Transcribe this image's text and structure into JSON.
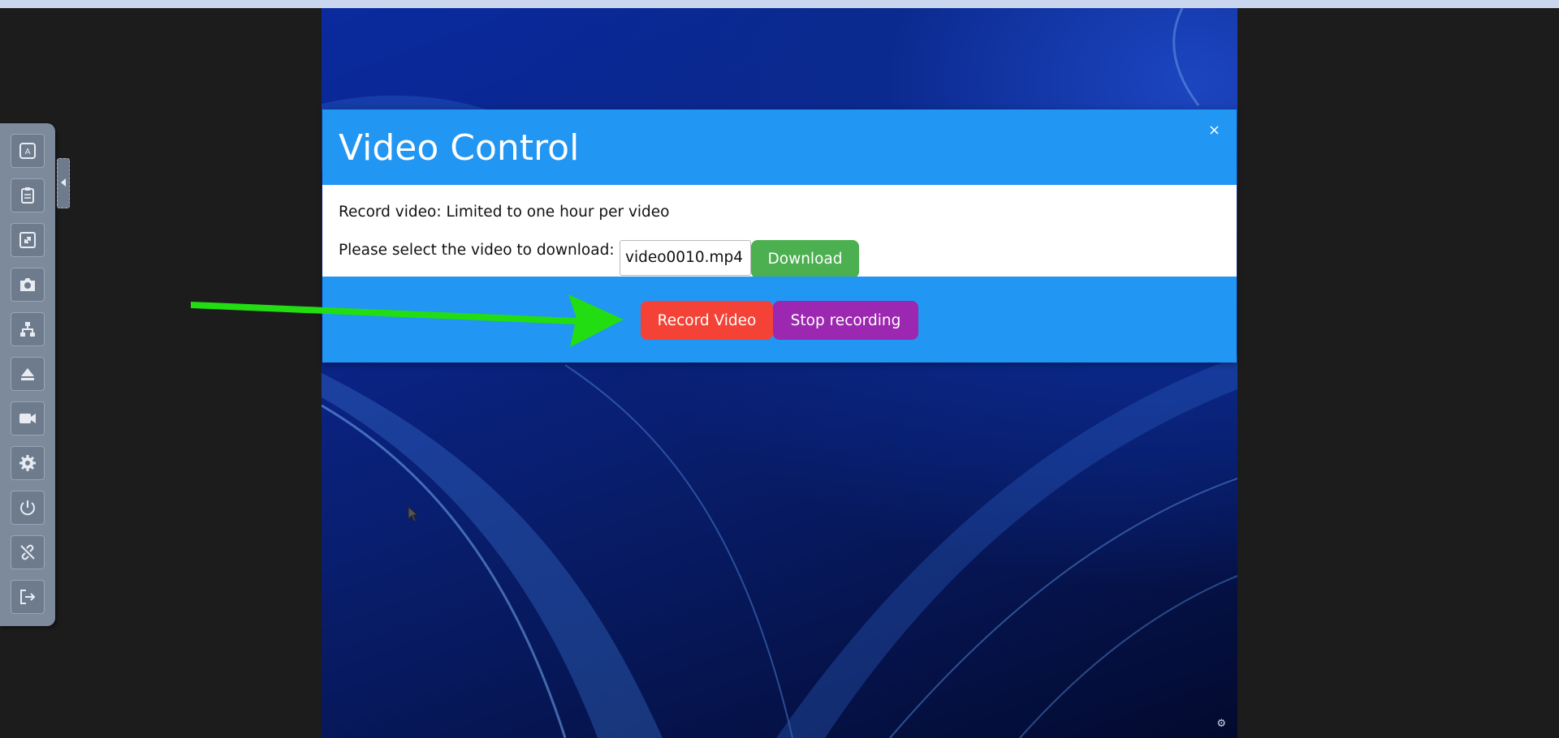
{
  "modal": {
    "title": "Video Control",
    "close_label": "×",
    "record_note": "Record video: Limited to one hour per video",
    "select_label": "Please select the video to download:",
    "selected_file": "video0010.mp4",
    "download_label": "Download",
    "record_label": "Record Video",
    "stop_label": "Stop recording"
  },
  "sidebar": {
    "items": [
      {
        "icon": "keyboard-a-icon"
      },
      {
        "icon": "clipboard-icon"
      },
      {
        "icon": "resize-icon"
      },
      {
        "icon": "camera-icon"
      },
      {
        "icon": "network-icon"
      },
      {
        "icon": "eject-icon"
      },
      {
        "icon": "video-camera-icon"
      },
      {
        "icon": "gear-icon"
      },
      {
        "icon": "power-icon"
      },
      {
        "icon": "disconnect-icon"
      },
      {
        "icon": "logout-icon"
      }
    ]
  },
  "colors": {
    "header_blue": "#2196f3",
    "download_green": "#4caf50",
    "record_red": "#f44336",
    "stop_purple": "#9c27b0",
    "annotation_arrow": "#22dd11"
  }
}
